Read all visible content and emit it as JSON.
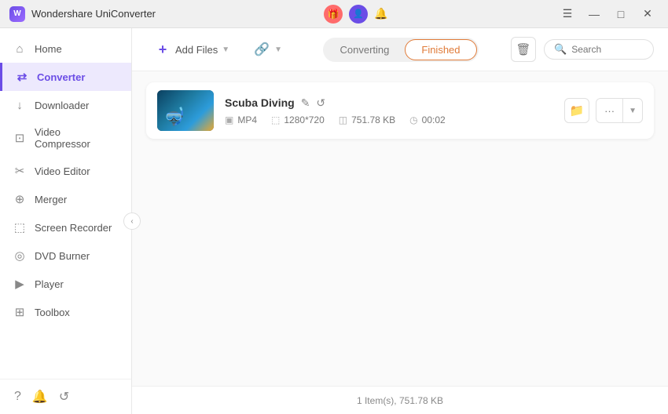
{
  "titleBar": {
    "appName": "Wondershare UniConverter",
    "controls": {
      "minimize": "—",
      "maximize": "□",
      "close": "✕"
    }
  },
  "sidebar": {
    "items": [
      {
        "id": "home",
        "label": "Home",
        "icon": "⌂",
        "active": false
      },
      {
        "id": "converter",
        "label": "Converter",
        "icon": "⇄",
        "active": true
      },
      {
        "id": "downloader",
        "label": "Downloader",
        "icon": "↓",
        "active": false
      },
      {
        "id": "video-compressor",
        "label": "Video Compressor",
        "icon": "⊡",
        "active": false
      },
      {
        "id": "video-editor",
        "label": "Video Editor",
        "icon": "✂",
        "active": false
      },
      {
        "id": "merger",
        "label": "Merger",
        "icon": "⊕",
        "active": false
      },
      {
        "id": "screen-recorder",
        "label": "Screen Recorder",
        "icon": "⬚",
        "active": false
      },
      {
        "id": "dvd-burner",
        "label": "DVD Burner",
        "icon": "◎",
        "active": false
      },
      {
        "id": "player",
        "label": "Player",
        "icon": "▶",
        "active": false
      },
      {
        "id": "toolbox",
        "label": "Toolbox",
        "icon": "⊞",
        "active": false
      }
    ],
    "footer": {
      "help_icon": "?",
      "bell_icon": "🔔",
      "refresh_icon": "↺"
    },
    "collapse_label": "‹"
  },
  "toolbar": {
    "add_file_label": "Add Files",
    "add_url_label": "",
    "tabs": {
      "converting": "Converting",
      "finished": "Finished"
    },
    "active_tab": "Finished",
    "search_placeholder": "Search"
  },
  "fileList": {
    "items": [
      {
        "id": "scuba-diving",
        "name": "Scuba Diving",
        "format": "MP4",
        "resolution": "1280*720",
        "size": "751.78 KB",
        "duration": "00:02"
      }
    ]
  },
  "statusBar": {
    "text": "1 Item(s), 751.78 KB"
  }
}
